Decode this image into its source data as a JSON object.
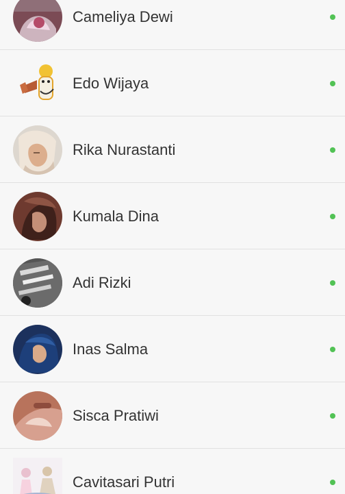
{
  "theme": {
    "accent": "#5e79b5",
    "online": "#52c255",
    "background": "#f7f7f7",
    "divider": "#e1e1e1",
    "text": "#333333"
  },
  "contacts": [
    {
      "name": "Cameliya Dewi",
      "avatar": "profile-photo-icon",
      "status": "online"
    },
    {
      "name": "Edo Wijaya",
      "avatar": "cartoon-avatar-icon",
      "status": "online"
    },
    {
      "name": "Rika Nurastanti",
      "avatar": "profile-photo-icon",
      "status": "online"
    },
    {
      "name": "Kumala Dina",
      "avatar": "profile-photo-icon",
      "status": "online"
    },
    {
      "name": "Adi Rizki",
      "avatar": "text-image-avatar-icon",
      "status": "online"
    },
    {
      "name": "Inas Salma",
      "avatar": "profile-photo-icon",
      "status": "online"
    },
    {
      "name": "Sisca Pratiwi",
      "avatar": "profile-photo-icon",
      "status": "online"
    },
    {
      "name": "Cavitasari Putri",
      "avatar": "sticker-avatar-icon",
      "status": "online"
    }
  ]
}
